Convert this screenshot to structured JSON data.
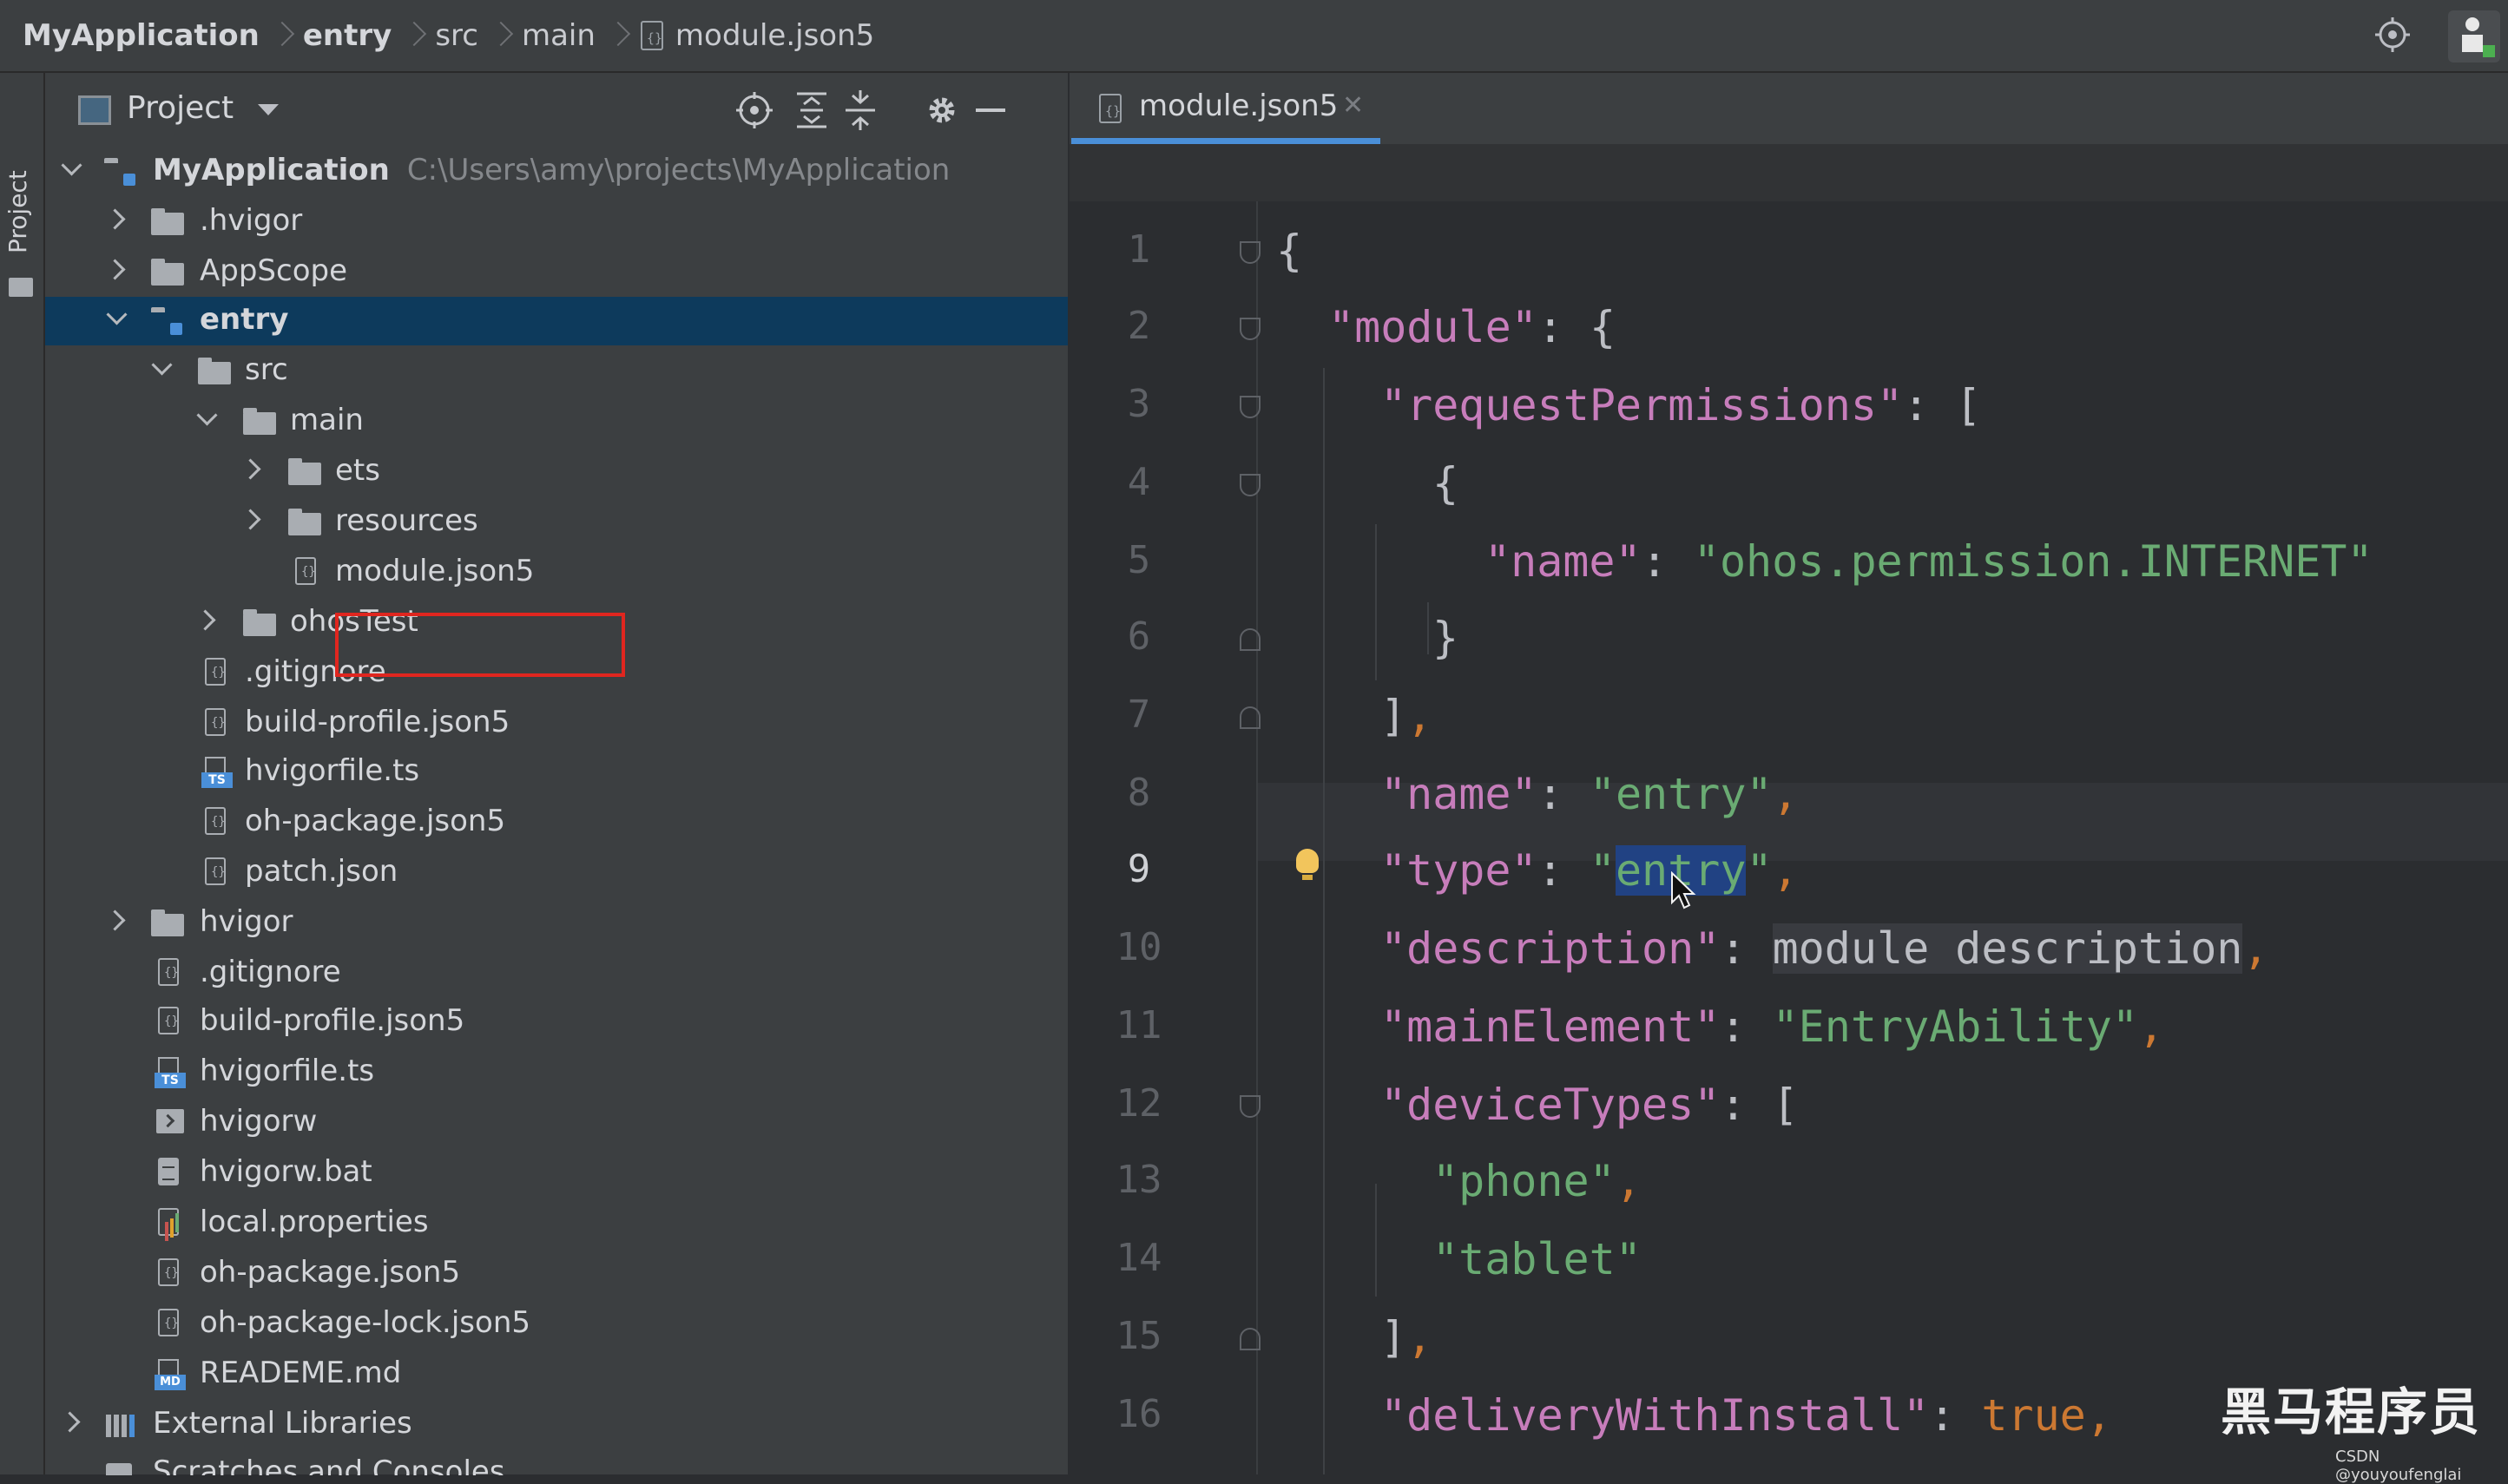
{
  "breadcrumb": {
    "items": [
      "MyApplication",
      "entry",
      "src",
      "main",
      "module.json5"
    ]
  },
  "sidebar_strip": {
    "label": "Project"
  },
  "project_panel": {
    "title": "Project",
    "tree": [
      {
        "label": "MyApplication",
        "path": "C:\\Users\\amy\\projects\\MyApplication",
        "icon": "module-folder-icon",
        "bold": true
      },
      {
        "label": ".hvigor",
        "icon": "folder-icon"
      },
      {
        "label": "AppScope",
        "icon": "folder-icon"
      },
      {
        "label": "entry",
        "icon": "module-folder-icon",
        "bold": true
      },
      {
        "label": "src",
        "icon": "folder-icon"
      },
      {
        "label": "main",
        "icon": "folder-icon"
      },
      {
        "label": "ets",
        "icon": "folder-icon"
      },
      {
        "label": "resources",
        "icon": "folder-icon"
      },
      {
        "label": "module.json5",
        "icon": "json-file-icon"
      },
      {
        "label": "ohosTest",
        "icon": "folder-icon"
      },
      {
        "label": ".gitignore",
        "icon": "ignore-file-icon"
      },
      {
        "label": "build-profile.json5",
        "icon": "json-file-icon"
      },
      {
        "label": "hvigorfile.ts",
        "icon": "ts-file-icon"
      },
      {
        "label": "oh-package.json5",
        "icon": "json-file-icon"
      },
      {
        "label": "patch.json",
        "icon": "json-file-icon"
      },
      {
        "label": "hvigor",
        "icon": "folder-icon"
      },
      {
        "label": ".gitignore",
        "icon": "ignore-file-icon"
      },
      {
        "label": "build-profile.json5",
        "icon": "json-file-icon"
      },
      {
        "label": "hvigorfile.ts",
        "icon": "ts-file-icon"
      },
      {
        "label": "hvigorw",
        "icon": "terminal-file-icon"
      },
      {
        "label": "hvigorw.bat",
        "icon": "bat-file-icon"
      },
      {
        "label": "local.properties",
        "icon": "properties-file-icon"
      },
      {
        "label": "oh-package.json5",
        "icon": "json-file-icon"
      },
      {
        "label": "oh-package-lock.json5",
        "icon": "json-file-icon"
      },
      {
        "label": "READEME.md",
        "icon": "markdown-file-icon"
      },
      {
        "label": "External Libraries",
        "icon": "libraries-icon"
      },
      {
        "label": "Scratches and Consoles",
        "icon": "scratches-icon"
      }
    ]
  },
  "editor": {
    "tab_label": "module.json5",
    "line_numbers": [
      "1",
      "2",
      "3",
      "4",
      "5",
      "6",
      "7",
      "8",
      "9",
      "10",
      "11",
      "12",
      "13",
      "14",
      "15",
      "16"
    ],
    "current_line": "9",
    "code": {
      "l1": "{",
      "k_module": "\"module\"",
      "k_reqperm": "\"requestPermissions\"",
      "k_name1": "\"name\"",
      "v_internet": "\"ohos.permission.INTERNET\"",
      "k_name2": "\"name\"",
      "v_entry1": "\"entry\"",
      "k_type": "\"type\"",
      "v_entry2_q1": "\"",
      "v_entry2_sel": "entry",
      "v_entry2_q2": "\"",
      "k_desc": "\"description\"",
      "v_desc": "module description",
      "k_main": "\"mainElement\"",
      "v_main": "\"EntryAbility\"",
      "k_device": "\"deviceTypes\"",
      "v_phone": "\"phone\"",
      "v_tablet": "\"tablet\"",
      "k_delivery": "\"deliveryWithInstall\"",
      "v_true": "true"
    }
  },
  "watermark": {
    "main": "黑马程序员",
    "sub": "CSDN @youyoufenglai"
  },
  "colors": {
    "accent": "#4a8fd8",
    "selection": "#0d3a5c",
    "highlight_box": "#e0261f"
  }
}
